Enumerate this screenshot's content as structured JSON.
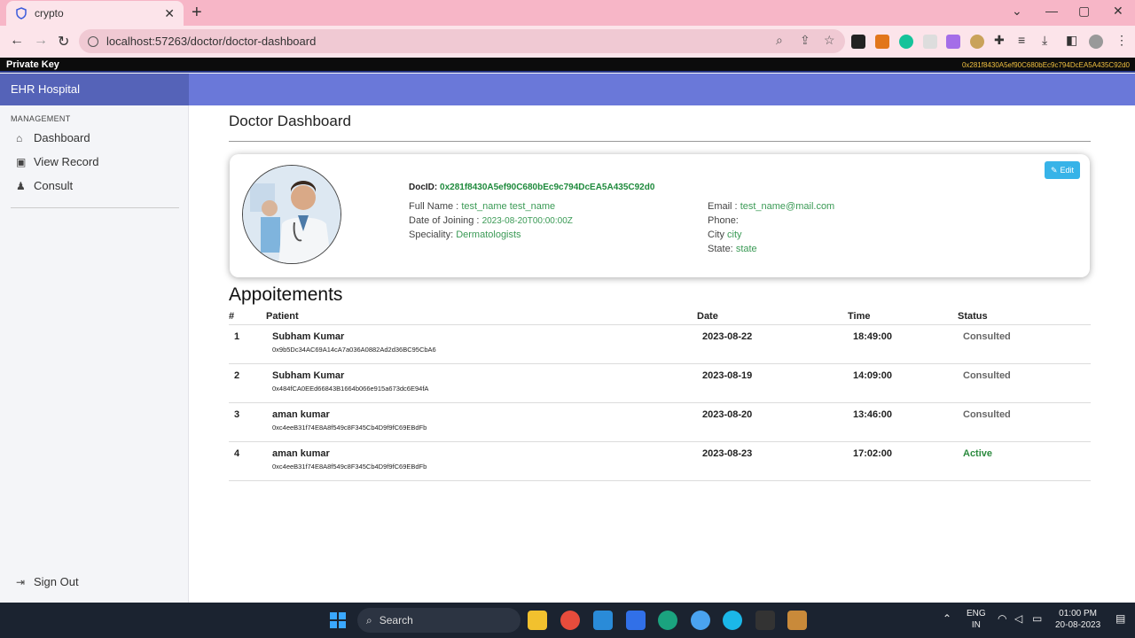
{
  "browser": {
    "tab_title": "crypto",
    "url": "localhost:57263/doctor/doctor-dashboard"
  },
  "keybar": {
    "label": "Private Key",
    "value": "0x281f8430A5ef90C680bEc9c794DcEA5A435C92d0"
  },
  "app": {
    "brand": "EHR Hospital"
  },
  "sidebar": {
    "heading": "MANAGEMENT",
    "items": [
      {
        "label": "Dashboard",
        "icon": "home-icon"
      },
      {
        "label": "View Record",
        "icon": "clipboard-icon"
      },
      {
        "label": "Consult",
        "icon": "user-doctor-icon"
      }
    ],
    "signout": "Sign Out"
  },
  "main": {
    "title": "Doctor Dashboard",
    "edit_label": "Edit",
    "docid_label": "DocID:",
    "docid_value": "0x281f8430A5ef90C680bEc9c794DcEA5A435C92d0",
    "fullname_label": "Full Name :",
    "fullname_value": "test_name test_name",
    "joining_label": "Date of Joining :",
    "joining_value": "2023-08-20T00:00:00Z",
    "speciality_label": "Speciality:",
    "speciality_value": "Dermatologists",
    "email_label": "Email :",
    "email_value": "test_name@mail.com",
    "phone_label": "Phone:",
    "phone_value": "",
    "city_label": "City",
    "city_value": "city",
    "state_label": "State:",
    "state_value": "state"
  },
  "appointments": {
    "title": "Appoitements",
    "headers": [
      "#",
      "Patient",
      "Date",
      "Time",
      "Status"
    ],
    "rows": [
      {
        "num": "1",
        "name": "Subham Kumar",
        "address": "0x9b5Dc34AC69A14cA7a036A0882Ad2d36BC95CbA6",
        "date": "2023-08-22",
        "time": "18:49:00",
        "status": "Consulted"
      },
      {
        "num": "2",
        "name": "Subham Kumar",
        "address": "0x484fCA0EEd66843B1664b066e915a673dc6E94fA",
        "date": "2023-08-19",
        "time": "14:09:00",
        "status": "Consulted"
      },
      {
        "num": "3",
        "name": "aman kumar",
        "address": "0xc4eeB31f74E8A8f549c8F345Cb4D9f9fC69EBdFb",
        "date": "2023-08-20",
        "time": "13:46:00",
        "status": "Consulted"
      },
      {
        "num": "4",
        "name": "aman kumar",
        "address": "0xc4eeB31f74E8A8f549c8F345Cb4D9f9fC69EBdFb",
        "date": "2023-08-23",
        "time": "17:02:00",
        "status": "Active"
      }
    ]
  },
  "taskbar": {
    "search_label": "Search",
    "lang": "ENG",
    "region": "IN",
    "time": "01:00 PM",
    "date": "20-08-2023"
  }
}
